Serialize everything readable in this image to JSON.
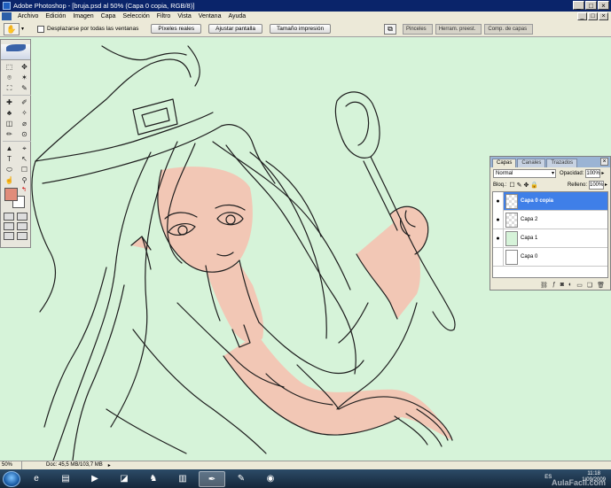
{
  "window": {
    "title": "Adobe Photoshop - [bruja.psd al 50% (Capa 0 copia, RGB/8)]",
    "minimize": "_",
    "maximize": "□",
    "close": "×"
  },
  "menu": [
    "Archivo",
    "Edición",
    "Imagen",
    "Capa",
    "Selección",
    "Filtro",
    "Vista",
    "Ventana",
    "Ayuda"
  ],
  "options": {
    "tool_icon": "hand-tool-icon",
    "checkbox_label": "Desplazarse por todas las ventanas",
    "buttons": [
      "Píxeles reales",
      "Ajustar pantalla",
      "Tamaño impresión"
    ]
  },
  "well_tabs": [
    "Pinceles",
    "Herram. preest.",
    "Comp. de capas"
  ],
  "toolbox": {
    "tools": [
      "⬚",
      "✥",
      "⌾",
      "✶",
      "⛶",
      "✎",
      "✚",
      "✐",
      "♣",
      "✧",
      "◫",
      "⌀",
      "✏",
      "⊙",
      "▲",
      "⌖",
      "T",
      "↖",
      "⬭",
      "☐",
      "☝",
      "⚲"
    ],
    "foreground_color": "#e08c7a",
    "background_color": "#ffffff"
  },
  "layers_panel": {
    "tabs": [
      "Capas",
      "Canales",
      "Trazados"
    ],
    "blend_mode": "Normal",
    "opacity_label": "Opacidad:",
    "opacity_value": "100%",
    "lock_label": "Bloq.:",
    "fill_label": "Relleno:",
    "fill_value": "100%",
    "layers": [
      {
        "name": "Capa 0 copia",
        "visible": true,
        "selected": true
      },
      {
        "name": "Capa 2",
        "visible": true,
        "selected": false
      },
      {
        "name": "Capa 1",
        "visible": true,
        "selected": false
      },
      {
        "name": "Capa 0",
        "visible": false,
        "selected": false
      }
    ]
  },
  "status": {
    "zoom": "50%",
    "doc": "Doc: 45,5 MB/103,7 MB"
  },
  "taskbar": {
    "language": "ES",
    "time": "11:18",
    "date": "1/09/2009",
    "watermark": "AulaFacil.com"
  },
  "colors": {
    "canvas_bg": "#d6f3d9",
    "skin": "#f2c7b5",
    "selection": "#3f7fe8"
  }
}
